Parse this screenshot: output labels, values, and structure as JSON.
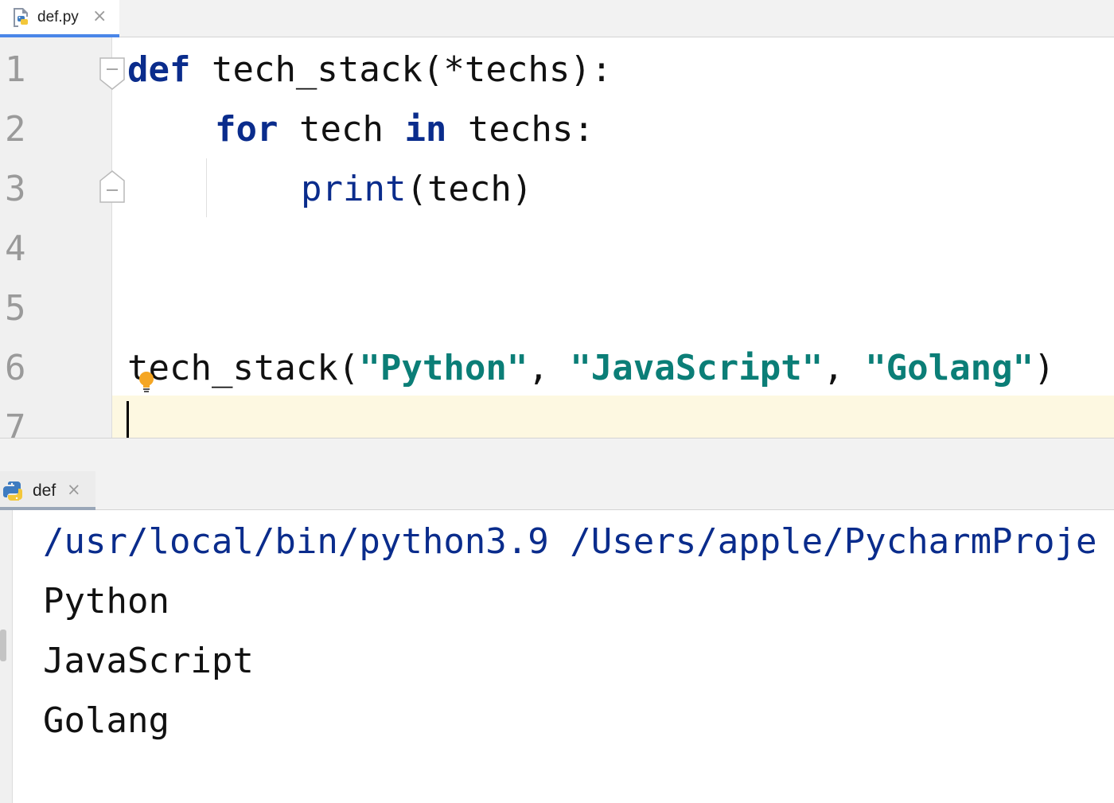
{
  "editor_tab": {
    "label": "def.py",
    "close": "×"
  },
  "editor": {
    "line_numbers": [
      "1",
      "2",
      "3",
      "4",
      "5",
      "6",
      "7"
    ],
    "code": {
      "l1": {
        "kw": "def",
        "rest": " tech_stack(*techs):"
      },
      "l2": {
        "kw_for": "for",
        "mid": " tech ",
        "kw_in": "in",
        "rest": " techs:"
      },
      "l3": {
        "builtin": "print",
        "rest": "(tech)"
      },
      "l6": {
        "call": "tech_stack(",
        "arg1": "\"Python\"",
        "sep1": ", ",
        "arg2": "\"JavaScript\"",
        "sep2": ", ",
        "arg3": "\"Golang\"",
        "close": ")"
      }
    }
  },
  "run_tab": {
    "label": "def",
    "close": "×"
  },
  "console": {
    "command": "/usr/local/bin/python3.9 /Users/apple/PycharmProje",
    "output": [
      "Python",
      "JavaScript",
      "Golang"
    ]
  },
  "colors": {
    "keyword": "#0a2c8c",
    "string": "#0b7e77",
    "current_line": "#fdf8e1",
    "tab_underline": "#4a86e8"
  },
  "icons": {
    "file_tab": "python-file-icon",
    "run_tab": "python-icon",
    "fold": "fold-marker-icon",
    "intention": "lightbulb-icon"
  }
}
